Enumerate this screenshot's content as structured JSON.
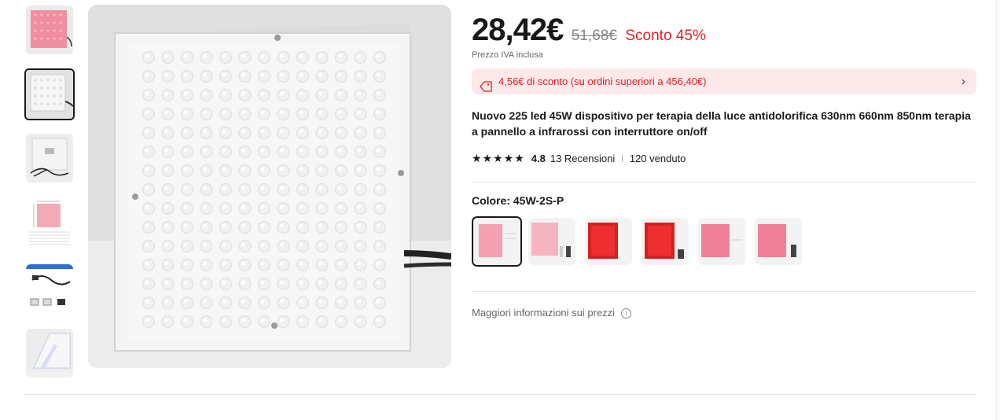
{
  "gallery": {
    "thumbnails": [
      "thumb-panel-front-red",
      "thumb-panel-front-white",
      "thumb-panel-back-cable",
      "thumb-dimensions-chart",
      "thumb-accessories",
      "thumb-stand"
    ],
    "active_index": 1
  },
  "price": {
    "current": "28,42€",
    "original": "51,68€",
    "discount": "Sconto 45%",
    "vat_note": "Prezzo IVA inclusa"
  },
  "coupon": {
    "text": "4,56€ di sconto (su ordini superiori a 456,40€)",
    "icon": "tag-icon"
  },
  "product": {
    "title": "Nuovo 225 led 45W dispositivo per terapia della luce antidolorifica 630nm 660nm 850nm terapia a pannello a infrarossi con interruttore on/off"
  },
  "rating": {
    "stars": 5,
    "score": "4.8",
    "reviews": "13 Recensioni",
    "separator": "|",
    "sold": "120 venduto"
  },
  "color": {
    "label": "Colore: 45W-2S-P",
    "options": [
      "45W-2S-P",
      "option-2",
      "option-3",
      "option-4",
      "option-5",
      "option-6"
    ],
    "selected_index": 0
  },
  "more_info": {
    "label": "Maggiori informazioni sui prezzi",
    "icon": "info-icon"
  },
  "colors": {
    "discount_red": "#e02020",
    "coupon_bg": "#fde8ea",
    "text_dark": "#191919"
  }
}
